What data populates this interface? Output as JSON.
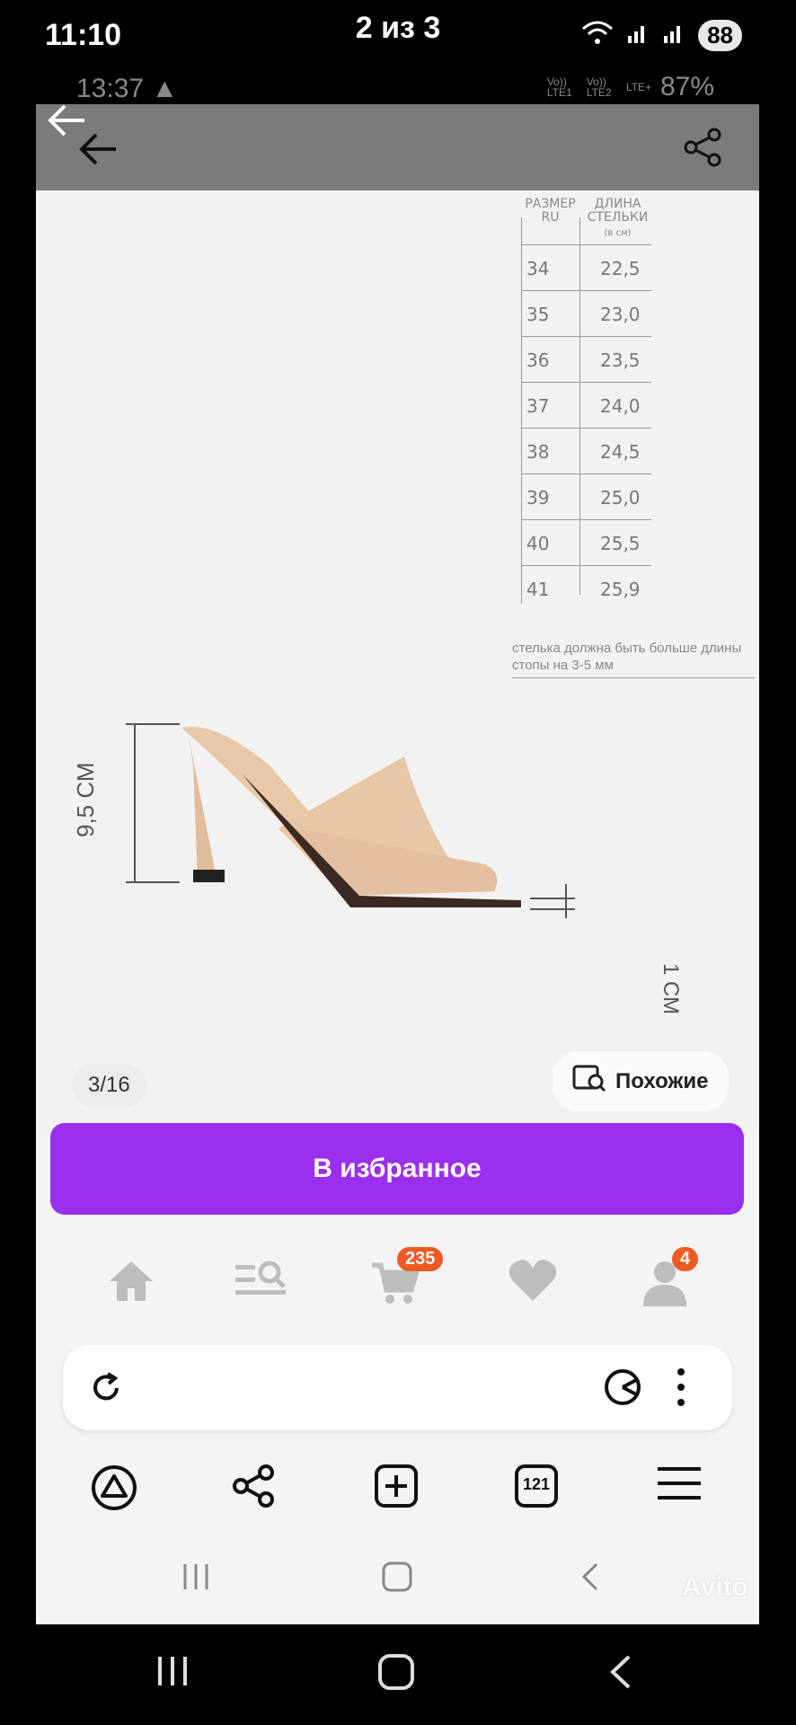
{
  "outer_status": {
    "time": "11:10",
    "battery": "88"
  },
  "viewer": {
    "title": "2 из 3"
  },
  "inner_status": {
    "time": "13:37",
    "sim1": "Vo)) LTE1",
    "sim2": "Vo)) LTE2",
    "net": "LTE+",
    "battery": "87%"
  },
  "size_table": {
    "header_size": "РАЗМЕР RU",
    "header_length": "ДЛИНА СТЕЛЬКИ",
    "header_unit": "(в см)",
    "rows": [
      {
        "size": "34",
        "length": "22,5"
      },
      {
        "size": "35",
        "length": "23,0"
      },
      {
        "size": "36",
        "length": "23,5"
      },
      {
        "size": "37",
        "length": "24,0"
      },
      {
        "size": "38",
        "length": "24,5"
      },
      {
        "size": "39",
        "length": "25,0"
      },
      {
        "size": "40",
        "length": "25,5"
      },
      {
        "size": "41",
        "length": "25,9"
      }
    ],
    "note": "стелька должна быть больше длины стопы на 3-5 мм"
  },
  "shoe": {
    "heel_height": "9,5 СМ",
    "platform": "1 СМ"
  },
  "gallery": {
    "counter": "3/16",
    "similar_label": "Похожие"
  },
  "actions": {
    "favorite_label": "В избранное"
  },
  "bottom_nav": {
    "cart_badge": "235",
    "profile_badge": "4"
  },
  "browser": {
    "tabs_count": "121"
  },
  "watermark": "Avito"
}
